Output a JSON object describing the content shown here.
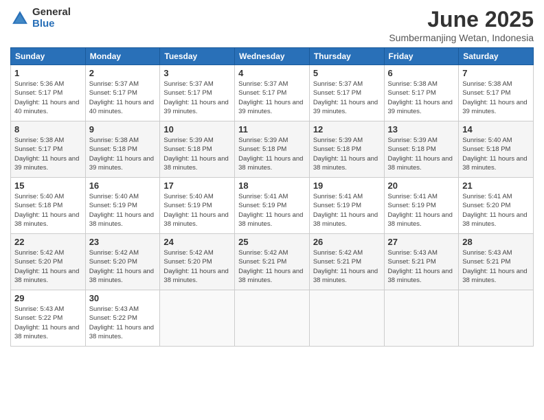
{
  "logo": {
    "general": "General",
    "blue": "Blue"
  },
  "title": "June 2025",
  "subtitle": "Sumbermanjing Wetan, Indonesia",
  "days_header": [
    "Sunday",
    "Monday",
    "Tuesday",
    "Wednesday",
    "Thursday",
    "Friday",
    "Saturday"
  ],
  "weeks": [
    [
      {
        "day": "1",
        "sunrise": "5:36 AM",
        "sunset": "5:17 PM",
        "daylight": "11 hours and 40 minutes."
      },
      {
        "day": "2",
        "sunrise": "5:37 AM",
        "sunset": "5:17 PM",
        "daylight": "11 hours and 40 minutes."
      },
      {
        "day": "3",
        "sunrise": "5:37 AM",
        "sunset": "5:17 PM",
        "daylight": "11 hours and 39 minutes."
      },
      {
        "day": "4",
        "sunrise": "5:37 AM",
        "sunset": "5:17 PM",
        "daylight": "11 hours and 39 minutes."
      },
      {
        "day": "5",
        "sunrise": "5:37 AM",
        "sunset": "5:17 PM",
        "daylight": "11 hours and 39 minutes."
      },
      {
        "day": "6",
        "sunrise": "5:38 AM",
        "sunset": "5:17 PM",
        "daylight": "11 hours and 39 minutes."
      },
      {
        "day": "7",
        "sunrise": "5:38 AM",
        "sunset": "5:17 PM",
        "daylight": "11 hours and 39 minutes."
      }
    ],
    [
      {
        "day": "8",
        "sunrise": "5:38 AM",
        "sunset": "5:17 PM",
        "daylight": "11 hours and 39 minutes."
      },
      {
        "day": "9",
        "sunrise": "5:38 AM",
        "sunset": "5:18 PM",
        "daylight": "11 hours and 39 minutes."
      },
      {
        "day": "10",
        "sunrise": "5:39 AM",
        "sunset": "5:18 PM",
        "daylight": "11 hours and 38 minutes."
      },
      {
        "day": "11",
        "sunrise": "5:39 AM",
        "sunset": "5:18 PM",
        "daylight": "11 hours and 38 minutes."
      },
      {
        "day": "12",
        "sunrise": "5:39 AM",
        "sunset": "5:18 PM",
        "daylight": "11 hours and 38 minutes."
      },
      {
        "day": "13",
        "sunrise": "5:39 AM",
        "sunset": "5:18 PM",
        "daylight": "11 hours and 38 minutes."
      },
      {
        "day": "14",
        "sunrise": "5:40 AM",
        "sunset": "5:18 PM",
        "daylight": "11 hours and 38 minutes."
      }
    ],
    [
      {
        "day": "15",
        "sunrise": "5:40 AM",
        "sunset": "5:18 PM",
        "daylight": "11 hours and 38 minutes."
      },
      {
        "day": "16",
        "sunrise": "5:40 AM",
        "sunset": "5:19 PM",
        "daylight": "11 hours and 38 minutes."
      },
      {
        "day": "17",
        "sunrise": "5:40 AM",
        "sunset": "5:19 PM",
        "daylight": "11 hours and 38 minutes."
      },
      {
        "day": "18",
        "sunrise": "5:41 AM",
        "sunset": "5:19 PM",
        "daylight": "11 hours and 38 minutes."
      },
      {
        "day": "19",
        "sunrise": "5:41 AM",
        "sunset": "5:19 PM",
        "daylight": "11 hours and 38 minutes."
      },
      {
        "day": "20",
        "sunrise": "5:41 AM",
        "sunset": "5:19 PM",
        "daylight": "11 hours and 38 minutes."
      },
      {
        "day": "21",
        "sunrise": "5:41 AM",
        "sunset": "5:20 PM",
        "daylight": "11 hours and 38 minutes."
      }
    ],
    [
      {
        "day": "22",
        "sunrise": "5:42 AM",
        "sunset": "5:20 PM",
        "daylight": "11 hours and 38 minutes."
      },
      {
        "day": "23",
        "sunrise": "5:42 AM",
        "sunset": "5:20 PM",
        "daylight": "11 hours and 38 minutes."
      },
      {
        "day": "24",
        "sunrise": "5:42 AM",
        "sunset": "5:20 PM",
        "daylight": "11 hours and 38 minutes."
      },
      {
        "day": "25",
        "sunrise": "5:42 AM",
        "sunset": "5:21 PM",
        "daylight": "11 hours and 38 minutes."
      },
      {
        "day": "26",
        "sunrise": "5:42 AM",
        "sunset": "5:21 PM",
        "daylight": "11 hours and 38 minutes."
      },
      {
        "day": "27",
        "sunrise": "5:43 AM",
        "sunset": "5:21 PM",
        "daylight": "11 hours and 38 minutes."
      },
      {
        "day": "28",
        "sunrise": "5:43 AM",
        "sunset": "5:21 PM",
        "daylight": "11 hours and 38 minutes."
      }
    ],
    [
      {
        "day": "29",
        "sunrise": "5:43 AM",
        "sunset": "5:22 PM",
        "daylight": "11 hours and 38 minutes."
      },
      {
        "day": "30",
        "sunrise": "5:43 AM",
        "sunset": "5:22 PM",
        "daylight": "11 hours and 38 minutes."
      },
      null,
      null,
      null,
      null,
      null
    ]
  ]
}
